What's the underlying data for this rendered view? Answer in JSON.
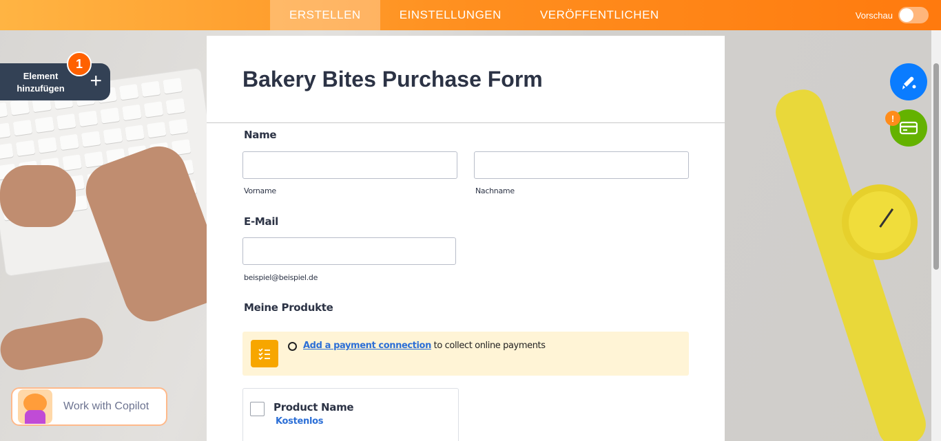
{
  "topbar": {
    "tabs": [
      {
        "label": "ERSTELLEN",
        "active": true
      },
      {
        "label": "EINSTELLUNGEN",
        "active": false
      },
      {
        "label": "VERÖFFENTLICHEN",
        "active": false
      }
    ],
    "preview_label": "Vorschau",
    "preview_on": false
  },
  "sidebar": {
    "add_element_label": "Element hinzufügen",
    "badge_count": "1"
  },
  "form": {
    "title": "Bakery Bites Purchase Form",
    "name_label": "Name",
    "first_name_sub": "Vorname",
    "last_name_sub": "Nachname",
    "email_label": "E-Mail",
    "email_sub": "beispiel@beispiel.de",
    "products_label": "Meine Produkte",
    "notice_link": "Add a payment connection",
    "notice_text": " to collect online payments",
    "product": {
      "name": "Product Name",
      "price": "Kostenlos"
    }
  },
  "right_tools": {
    "warning": "!"
  },
  "copilot": {
    "label": "Work with Copilot"
  },
  "colors": {
    "accent": "#ff8f1f",
    "theme_button": "#0a7cff",
    "payment_button": "#64b200",
    "link": "#2c6fd6"
  }
}
